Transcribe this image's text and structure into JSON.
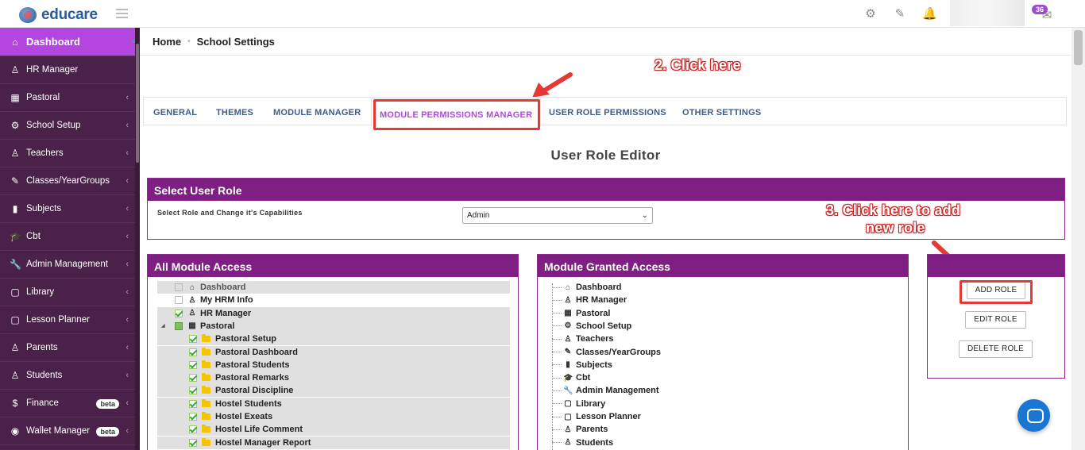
{
  "app": {
    "logo_text": "educare",
    "notif_count": "36"
  },
  "sidebar": {
    "items": [
      {
        "label": "Dashboard",
        "icon": "home-icon",
        "glyph": "⌂"
      },
      {
        "label": "HR Manager",
        "icon": "user-tie-icon",
        "glyph": "♙"
      },
      {
        "label": "Pastoral",
        "icon": "table-icon",
        "glyph": "▦"
      },
      {
        "label": "School Setup",
        "icon": "gear-icon",
        "glyph": "⚙"
      },
      {
        "label": "Teachers",
        "icon": "user-tie-icon",
        "glyph": "♙"
      },
      {
        "label": "Classes/YearGroups",
        "icon": "edit-icon",
        "glyph": "✎"
      },
      {
        "label": "Subjects",
        "icon": "book-icon",
        "glyph": "▮"
      },
      {
        "label": "Cbt",
        "icon": "graduation-cap-icon",
        "glyph": "🎓"
      },
      {
        "label": "Admin Management",
        "icon": "wrench-icon",
        "glyph": "🔧"
      },
      {
        "label": "Library",
        "icon": "library-icon",
        "glyph": "▢"
      },
      {
        "label": "Lesson Planner",
        "icon": "planner-icon",
        "glyph": "▢"
      },
      {
        "label": "Parents",
        "icon": "user-icon",
        "glyph": "♙"
      },
      {
        "label": "Students",
        "icon": "user-icon",
        "glyph": "♙"
      },
      {
        "label": "Finance",
        "icon": "dollar-icon",
        "glyph": "$",
        "badge": "beta"
      },
      {
        "label": "Wallet Manager",
        "icon": "wallet-icon",
        "glyph": "◉",
        "badge": "beta"
      }
    ]
  },
  "breadcrumb": {
    "home": "Home",
    "current": "School Settings"
  },
  "annotations": {
    "step2": "2. Click here",
    "step3_line1": "3. Click here to add",
    "step3_line2": "new role"
  },
  "tabs": [
    {
      "label": "GENERAL"
    },
    {
      "label": "THEMES"
    },
    {
      "label": "MODULE MANAGER"
    },
    {
      "label": "MODULE PERMISSIONS MANAGER"
    },
    {
      "label": "USER ROLE PERMISSIONS"
    },
    {
      "label": "OTHER SETTINGS"
    }
  ],
  "editor": {
    "title": "User Role Editor"
  },
  "select_role": {
    "heading": "Select User Role",
    "label": "Select Role and Change it's Capabilities",
    "value": "Admin"
  },
  "all_access": {
    "heading": "All Module Access",
    "rows": [
      {
        "label": "Dashboard",
        "state": "grey"
      },
      {
        "label": "My HRM Info",
        "state": "off"
      },
      {
        "label": "HR Manager",
        "state": "on"
      },
      {
        "label": "Pastoral",
        "state": "partial"
      },
      {
        "label": "Pastoral Setup",
        "state": "on"
      },
      {
        "label": "Pastoral Dashboard",
        "state": "on"
      },
      {
        "label": "Pastoral Students",
        "state": "on"
      },
      {
        "label": "Pastoral Remarks",
        "state": "on"
      },
      {
        "label": "Pastoral Discipline",
        "state": "on"
      },
      {
        "label": "Hostel Students",
        "state": "on"
      },
      {
        "label": "Hostel Exeats",
        "state": "on"
      },
      {
        "label": "Hostel Life Comment",
        "state": "on"
      },
      {
        "label": "Hostel Manager Report",
        "state": "on"
      }
    ]
  },
  "granted_access": {
    "heading": "Module Granted Access",
    "rows": [
      {
        "label": "Dashboard",
        "glyph": "⌂"
      },
      {
        "label": "HR Manager",
        "glyph": "♙"
      },
      {
        "label": "Pastoral",
        "glyph": "▦"
      },
      {
        "label": "School Setup",
        "glyph": "⚙"
      },
      {
        "label": "Teachers",
        "glyph": "♙"
      },
      {
        "label": "Classes/YearGroups",
        "glyph": "✎"
      },
      {
        "label": "Subjects",
        "glyph": "▮"
      },
      {
        "label": "Cbt",
        "glyph": "🎓"
      },
      {
        "label": "Admin Management",
        "glyph": "🔧"
      },
      {
        "label": "Library",
        "glyph": "▢"
      },
      {
        "label": "Lesson Planner",
        "glyph": "▢"
      },
      {
        "label": "Parents",
        "glyph": "♙"
      },
      {
        "label": "Students",
        "glyph": "♙"
      }
    ]
  },
  "role_actions": {
    "add": "ADD ROLE",
    "edit": "EDIT ROLE",
    "delete": "DELETE ROLE"
  },
  "colors": {
    "sidebar_bg": "#4a2148",
    "active_item": "#b446e0",
    "panel_header": "#7f1f84",
    "tab_text": "#3e5d86",
    "highlight_red": "#e53935"
  }
}
